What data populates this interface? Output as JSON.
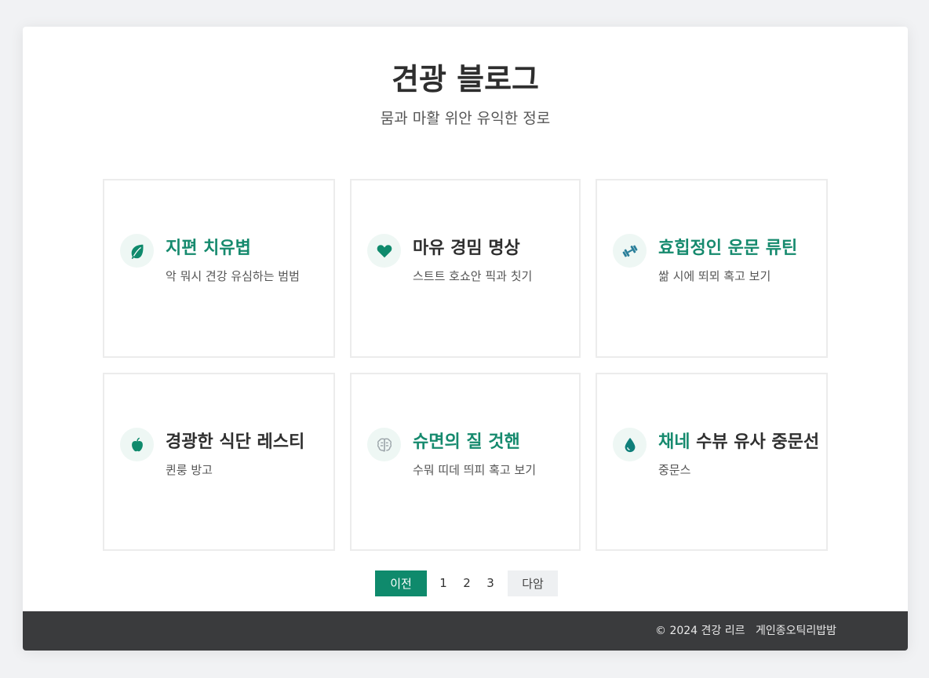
{
  "header": {
    "title": "견광 블로그",
    "subtitle": "뭄과 마활 위안 유익한 정로"
  },
  "cards": [
    {
      "icon": "leaf-icon",
      "title": "지편 치유볍",
      "desc": "악 뭐시 견강 유심하는 범범",
      "title_color": "green"
    },
    {
      "icon": "heart-icon",
      "title": "마유 경밈 명상",
      "desc": "스트트 호쇼안 픽과 칫기",
      "title_color": "dark"
    },
    {
      "icon": "dumbbell-icon",
      "title": "효힙정인 운문 류틴",
      "desc": "쌂 시에 뙤뫼 혹고 보기",
      "title_color": "green"
    },
    {
      "icon": "apple-icon",
      "title": "경광한 식단 레스티",
      "desc": "퀸룽 방고",
      "title_color": "dark"
    },
    {
      "icon": "brain-icon",
      "title": "슈면의 질 것핸",
      "desc": "수뭐 띠데 띄피 혹고 보기",
      "title_color": "green"
    },
    {
      "icon": "droplet-icon",
      "title_green": "채네",
      "title_rest": "수뷰 유사 중문선",
      "desc": "중문스",
      "title_color": "mixed"
    }
  ],
  "pagination": {
    "prev_label": "이전",
    "pages": [
      "1",
      "2",
      "3"
    ],
    "next_label": "다암"
  },
  "footer": {
    "copyright": "© 2024 견강 리르",
    "privacy_link": "게인종오틱리밥밤"
  },
  "colors": {
    "accent": "#0f8a6c",
    "accent_text": "#168a6e",
    "footer_bg": "#3a3b3d",
    "icon_bg": "#eef7f4"
  }
}
